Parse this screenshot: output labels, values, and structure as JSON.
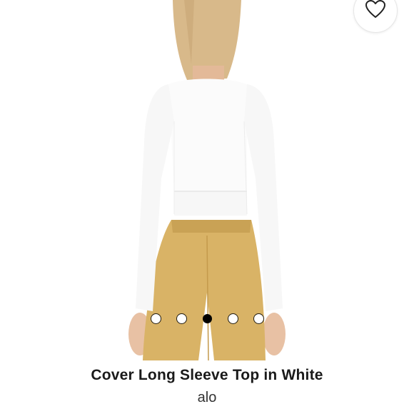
{
  "product": {
    "title": "Cover Long Sleeve Top in White",
    "brand": "alo"
  },
  "carousel": {
    "dot_count": 5,
    "active_index": 2
  },
  "favorite": {
    "icon": "heart-outline-icon"
  },
  "colors": {
    "top": "#ffffff",
    "pants": "#d9b366",
    "hair": "#d8b98a",
    "skin": "#e8c1a4"
  }
}
